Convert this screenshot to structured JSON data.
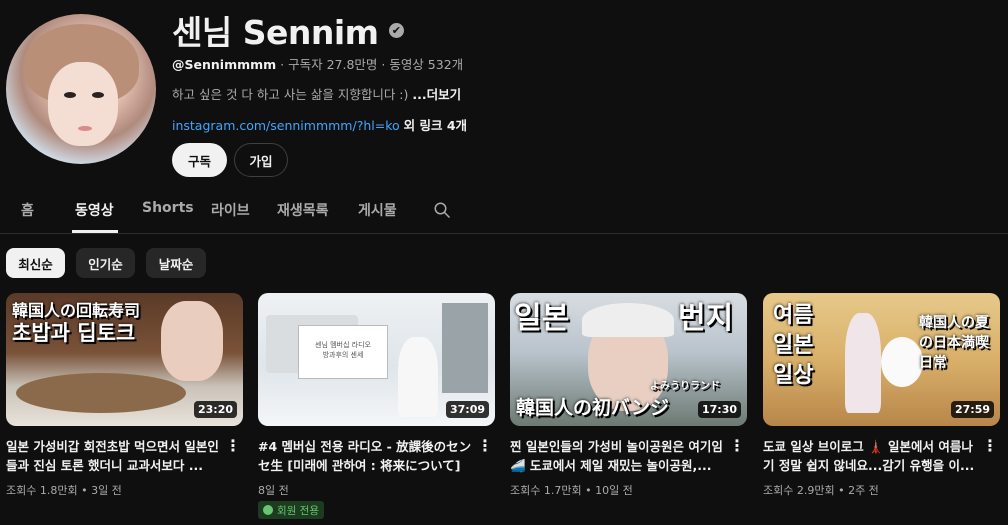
{
  "channel": {
    "name": "센님 Sennim",
    "verified_glyph": "✔",
    "handle": "@Sennimmmm",
    "stats": "· 구독자 27.8만명 · 동영상 532개",
    "description": "하고 싶은 것 다 하고 사는 삶을 지향합니다 :)",
    "more": "...더보기",
    "link_url": "instagram.com/sennimmmm/?hl=ko",
    "link_more": "외 링크 4개",
    "subscribe_label": "구독",
    "join_label": "가입"
  },
  "tabs": [
    "홈",
    "동영상",
    "Shorts",
    "라이브",
    "재생목록",
    "게시물"
  ],
  "active_tab": "동영상",
  "chips": [
    "최신순",
    "인기순",
    "날짜순"
  ],
  "selected_chip": "최신순",
  "videos": [
    {
      "title": "일본 가성비갑 회전초밥 먹으면서 일본인들과 진심 토론 했더니 교과서보다 ...",
      "meta": "조회수 1.8만회 • 3일 전",
      "duration": "23:20",
      "thumb_text": [
        "韓国人の回転寿司",
        "초밥과 딥토크"
      ]
    },
    {
      "title": "#4 멤버십 전용 라디오 - 放課後のセンセ生 [미래에 관하여 : 将来について]",
      "meta": "8일 전",
      "duration": "37:09",
      "badge": "회원 전용",
      "thumb_text": [
        "센님 멤버십 라디오",
        "방과후의 센세"
      ]
    },
    {
      "title": "찐 일본인들의 가성비 놀이공원은 여기임 🚄 도쿄에서 제일 재밌는 놀이공원,...",
      "meta": "조회수 1.7만회 • 10일 전",
      "duration": "17:30",
      "thumb_text": [
        "일본",
        "번지",
        "韓国人の初バンジ",
        "よみうりランド"
      ]
    },
    {
      "title": "도쿄 일상 브이로그 🗼 일본에서 여름나기 정말 쉽지 않네요...감기 유행을 이...",
      "meta": "조회수 2.9만회 • 2주 전",
      "duration": "27:59",
      "thumb_text": [
        "여름",
        "일본",
        "일상",
        "韓国人の夏の日本満喫日常"
      ]
    }
  ],
  "icons": {
    "search": "search-icon",
    "kebab": "⋮"
  }
}
